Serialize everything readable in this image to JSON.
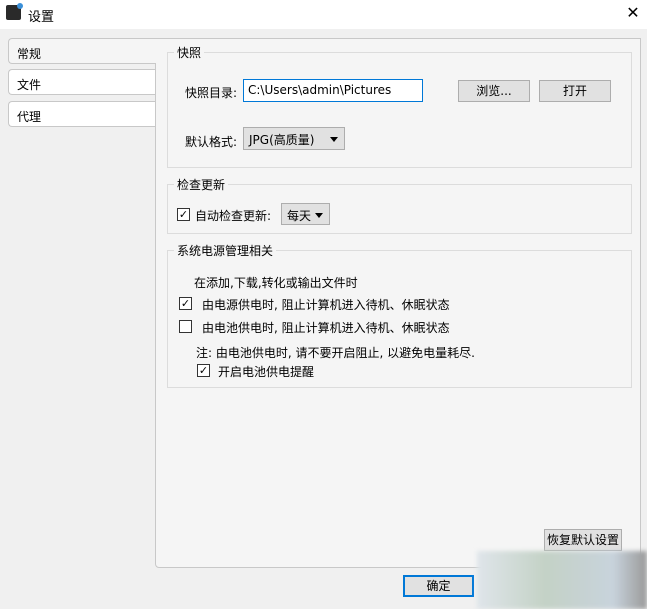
{
  "window": {
    "title": "设置",
    "close": "✕"
  },
  "tabs": [
    {
      "label": "常规"
    },
    {
      "label": "文件"
    },
    {
      "label": "代理"
    }
  ],
  "snapshot": {
    "group": "快照",
    "dir_label": "快照目录:",
    "dir_value": "C:\\Users\\admin\\Pictures",
    "browse": "浏览...",
    "open": "打开",
    "format_label": "默认格式:",
    "format_value": "JPG(高质量)"
  },
  "update": {
    "group": "检查更新",
    "auto_label": "自动检查更新:",
    "auto_checked": true,
    "freq": "每天"
  },
  "power": {
    "group": "系统电源管理相关",
    "intro": "在添加,下载,转化或输出文件时",
    "ac": {
      "label": "由电源供电时, 阻止计算机进入待机、休眠状态",
      "checked": true
    },
    "battery": {
      "label": "由电池供电时, 阻止计算机进入待机、休眠状态",
      "checked": false
    },
    "note": "注: 由电池供电时, 请不要开启阻止, 以避免电量耗尽.",
    "reminder": {
      "label": "开启电池供电提醒",
      "checked": true
    }
  },
  "buttons": {
    "restore": "恢复默认设置",
    "ok": "确定"
  },
  "check": "✓"
}
